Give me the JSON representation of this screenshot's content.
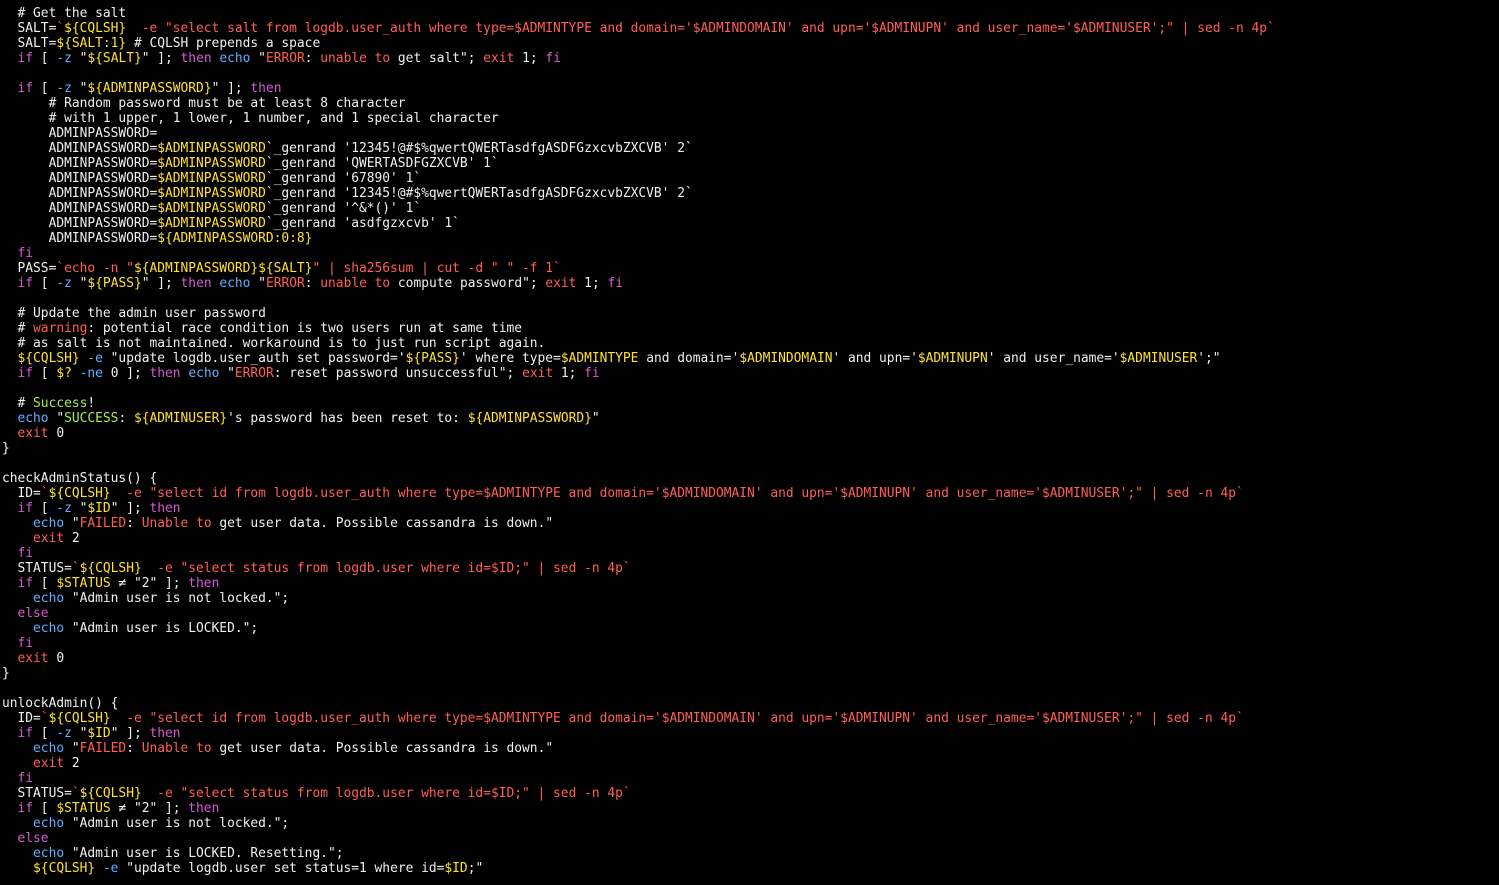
{
  "terminal": {
    "lines": [
      [
        [
          "w",
          "  # Get the salt"
        ]
      ],
      [
        [
          "w",
          "  SALT="
        ],
        [
          "r",
          "`"
        ],
        [
          "y",
          "${CQLSH}"
        ],
        [
          "r",
          "  -e \"select salt from logdb.user_auth where type=$ADMINTYPE and domain='$ADMINDOMAIN' and upn='$ADMINUPN' and user_name='$ADMINUSER';\" | sed -n 4p`"
        ]
      ],
      [
        [
          "w",
          "  SALT="
        ],
        [
          "y",
          "${SALT:1}"
        ],
        [
          "w",
          " # CQLSH prepends a space"
        ]
      ],
      [
        [
          "m",
          "  if"
        ],
        [
          "w",
          " [ "
        ],
        [
          "c",
          "-z"
        ],
        [
          "w",
          " \""
        ],
        [
          "y",
          "${SALT}"
        ],
        [
          "w",
          "\" ]; "
        ],
        [
          "m",
          "then"
        ],
        [
          "w",
          " "
        ],
        [
          "c",
          "echo"
        ],
        [
          "w",
          " \""
        ],
        [
          "r",
          "ERROR"
        ],
        [
          "w",
          ": "
        ],
        [
          "r",
          "unable"
        ],
        [
          "w",
          " "
        ],
        [
          "r",
          "to"
        ],
        [
          "w",
          " get salt\"; "
        ],
        [
          "r",
          "exit"
        ],
        [
          "w",
          " 1; "
        ],
        [
          "m",
          "fi"
        ]
      ],
      [
        [
          "w",
          ""
        ]
      ],
      [
        [
          "m",
          "  if"
        ],
        [
          "w",
          " [ "
        ],
        [
          "c",
          "-z"
        ],
        [
          "w",
          " \""
        ],
        [
          "y",
          "${ADMINPASSWORD}"
        ],
        [
          "w",
          "\" ]; "
        ],
        [
          "m",
          "then"
        ]
      ],
      [
        [
          "w",
          "      # Random password must be at least 8 character"
        ]
      ],
      [
        [
          "w",
          "      # with 1 upper, 1 lower, 1 number, and 1 special character"
        ]
      ],
      [
        [
          "w",
          "      ADMINPASSWORD="
        ]
      ],
      [
        [
          "w",
          "      ADMINPASSWORD="
        ],
        [
          "y",
          "$ADMINPASSWORD"
        ],
        [
          "w",
          "`_genrand '12345!@#$%qwertQWERTasdfgASDFGzxcvbZXCVB' 2`"
        ]
      ],
      [
        [
          "w",
          "      ADMINPASSWORD="
        ],
        [
          "y",
          "$ADMINPASSWORD"
        ],
        [
          "w",
          "`_genrand 'QWERTASDFGZXCVB' 1`"
        ]
      ],
      [
        [
          "w",
          "      ADMINPASSWORD="
        ],
        [
          "y",
          "$ADMINPASSWORD"
        ],
        [
          "w",
          "`_genrand '67890' 1`"
        ]
      ],
      [
        [
          "w",
          "      ADMINPASSWORD="
        ],
        [
          "y",
          "$ADMINPASSWORD"
        ],
        [
          "w",
          "`_genrand '12345!@#$%qwertQWERTasdfgASDFGzxcvbZXCVB' 2`"
        ]
      ],
      [
        [
          "w",
          "      ADMINPASSWORD="
        ],
        [
          "y",
          "$ADMINPASSWORD"
        ],
        [
          "w",
          "`_genrand '^&*()' 1`"
        ]
      ],
      [
        [
          "w",
          "      ADMINPASSWORD="
        ],
        [
          "y",
          "$ADMINPASSWORD"
        ],
        [
          "w",
          "`_genrand 'asdfgzxcvb' 1`"
        ]
      ],
      [
        [
          "w",
          "      ADMINPASSWORD="
        ],
        [
          "y",
          "${ADMINPASSWORD:0:8}"
        ]
      ],
      [
        [
          "m",
          "  fi"
        ]
      ],
      [
        [
          "w",
          "  PASS="
        ],
        [
          "r",
          "`echo -n \""
        ],
        [
          "y",
          "${ADMINPASSWORD}${SALT}"
        ],
        [
          "r",
          "\" | sha256sum | cut -d \" \" -f 1`"
        ]
      ],
      [
        [
          "m",
          "  if"
        ],
        [
          "w",
          " [ "
        ],
        [
          "c",
          "-z"
        ],
        [
          "w",
          " \""
        ],
        [
          "y",
          "${PASS}"
        ],
        [
          "w",
          "\" ]; "
        ],
        [
          "m",
          "then"
        ],
        [
          "w",
          " "
        ],
        [
          "c",
          "echo"
        ],
        [
          "w",
          " \""
        ],
        [
          "r",
          "ERROR"
        ],
        [
          "w",
          ": "
        ],
        [
          "r",
          "unable"
        ],
        [
          "w",
          " "
        ],
        [
          "r",
          "to"
        ],
        [
          "w",
          " compute password\"; "
        ],
        [
          "r",
          "exit"
        ],
        [
          "w",
          " 1; "
        ],
        [
          "m",
          "fi"
        ]
      ],
      [
        [
          "w",
          ""
        ]
      ],
      [
        [
          "w",
          "  # Update the admin user password"
        ]
      ],
      [
        [
          "w",
          "  # "
        ],
        [
          "r",
          "warning"
        ],
        [
          "w",
          ": potential race condition is two users run at same time"
        ]
      ],
      [
        [
          "w",
          "  # as salt is not maintained. workaround is to just run script again."
        ]
      ],
      [
        [
          "y",
          "  ${CQLSH}"
        ],
        [
          "w",
          " "
        ],
        [
          "c",
          "-e"
        ],
        [
          "w",
          " \"update logdb.user_auth set password='"
        ],
        [
          "y",
          "${PASS}"
        ],
        [
          "w",
          "' where type="
        ],
        [
          "y",
          "$ADMINTYPE"
        ],
        [
          "w",
          " and domain='"
        ],
        [
          "y",
          "$ADMINDOMAIN"
        ],
        [
          "w",
          "' and upn='"
        ],
        [
          "y",
          "$ADMINUPN"
        ],
        [
          "w",
          "' and user_name='"
        ],
        [
          "y",
          "$ADMINUSER"
        ],
        [
          "w",
          "';\""
        ]
      ],
      [
        [
          "m",
          "  if"
        ],
        [
          "w",
          " [ "
        ],
        [
          "y",
          "$?"
        ],
        [
          "w",
          " "
        ],
        [
          "c",
          "-ne"
        ],
        [
          "w",
          " 0 ]; "
        ],
        [
          "m",
          "then"
        ],
        [
          "w",
          " "
        ],
        [
          "c",
          "echo"
        ],
        [
          "w",
          " \""
        ],
        [
          "r",
          "ERROR"
        ],
        [
          "w",
          ": reset password unsuccessful\"; "
        ],
        [
          "r",
          "exit"
        ],
        [
          "w",
          " 1; "
        ],
        [
          "m",
          "fi"
        ]
      ],
      [
        [
          "w",
          ""
        ]
      ],
      [
        [
          "w",
          "  # "
        ],
        [
          "g",
          "Success"
        ],
        [
          "w",
          "!"
        ]
      ],
      [
        [
          "c",
          "  echo"
        ],
        [
          "w",
          " \""
        ],
        [
          "g",
          "SUCCESS"
        ],
        [
          "w",
          ": "
        ],
        [
          "y",
          "${ADMINUSER}"
        ],
        [
          "w",
          "'s password has been reset to: "
        ],
        [
          "y",
          "${ADMINPASSWORD}"
        ],
        [
          "w",
          "\""
        ]
      ],
      [
        [
          "r",
          "  exit"
        ],
        [
          "w",
          " 0"
        ]
      ],
      [
        [
          "w",
          "}"
        ]
      ],
      [
        [
          "w",
          ""
        ]
      ],
      [
        [
          "w",
          "checkAdminStatus() {"
        ]
      ],
      [
        [
          "w",
          "  ID="
        ],
        [
          "r",
          "`"
        ],
        [
          "y",
          "${CQLSH}"
        ],
        [
          "r",
          "  -e \"select id from logdb.user_auth where type=$ADMINTYPE and domain='$ADMINDOMAIN' and upn='$ADMINUPN' and user_name='$ADMINUSER';\" | sed -n 4p`"
        ]
      ],
      [
        [
          "m",
          "  if"
        ],
        [
          "w",
          " [ "
        ],
        [
          "c",
          "-z"
        ],
        [
          "w",
          " \""
        ],
        [
          "y",
          "$ID"
        ],
        [
          "w",
          "\" ]; "
        ],
        [
          "m",
          "then"
        ]
      ],
      [
        [
          "c",
          "    echo"
        ],
        [
          "w",
          " \""
        ],
        [
          "r",
          "FAILED"
        ],
        [
          "w",
          ": "
        ],
        [
          "r",
          "Unable"
        ],
        [
          "w",
          " "
        ],
        [
          "r",
          "to"
        ],
        [
          "w",
          " get user data. Possible cassandra is down.\""
        ]
      ],
      [
        [
          "r",
          "    exit"
        ],
        [
          "w",
          " 2"
        ]
      ],
      [
        [
          "m",
          "  fi"
        ]
      ],
      [
        [
          "w",
          "  STATUS="
        ],
        [
          "r",
          "`"
        ],
        [
          "y",
          "${CQLSH}"
        ],
        [
          "r",
          "  -e \"select status from logdb.user where id=$ID;\" | sed -n 4p`"
        ]
      ],
      [
        [
          "m",
          "  if"
        ],
        [
          "w",
          " [ "
        ],
        [
          "y",
          "$STATUS"
        ],
        [
          "w",
          " ≠ \"2\" ]; "
        ],
        [
          "m",
          "then"
        ]
      ],
      [
        [
          "c",
          "    echo"
        ],
        [
          "w",
          " \"Admin user is not locked.\";"
        ]
      ],
      [
        [
          "m",
          "  else"
        ]
      ],
      [
        [
          "c",
          "    echo"
        ],
        [
          "w",
          " \"Admin user is LOCKED.\";"
        ]
      ],
      [
        [
          "m",
          "  fi"
        ]
      ],
      [
        [
          "r",
          "  exit"
        ],
        [
          "w",
          " 0"
        ]
      ],
      [
        [
          "w",
          "}"
        ]
      ],
      [
        [
          "w",
          ""
        ]
      ],
      [
        [
          "w",
          "unlockAdmin() {"
        ]
      ],
      [
        [
          "w",
          "  ID="
        ],
        [
          "r",
          "`"
        ],
        [
          "y",
          "${CQLSH}"
        ],
        [
          "r",
          "  -e \"select id from logdb.user_auth where type=$ADMINTYPE and domain='$ADMINDOMAIN' and upn='$ADMINUPN' and user_name='$ADMINUSER';\" | sed -n 4p`"
        ]
      ],
      [
        [
          "m",
          "  if"
        ],
        [
          "w",
          " [ "
        ],
        [
          "c",
          "-z"
        ],
        [
          "w",
          " \""
        ],
        [
          "y",
          "$ID"
        ],
        [
          "w",
          "\" ]; "
        ],
        [
          "m",
          "then"
        ]
      ],
      [
        [
          "c",
          "    echo"
        ],
        [
          "w",
          " \""
        ],
        [
          "r",
          "FAILED"
        ],
        [
          "w",
          ": "
        ],
        [
          "r",
          "Unable"
        ],
        [
          "w",
          " "
        ],
        [
          "r",
          "to"
        ],
        [
          "w",
          " get user data. Possible cassandra is down.\""
        ]
      ],
      [
        [
          "r",
          "    exit"
        ],
        [
          "w",
          " 2"
        ]
      ],
      [
        [
          "m",
          "  fi"
        ]
      ],
      [
        [
          "w",
          "  STATUS="
        ],
        [
          "r",
          "`"
        ],
        [
          "y",
          "${CQLSH}"
        ],
        [
          "r",
          "  -e \"select status from logdb.user where id=$ID;\" | sed -n 4p`"
        ]
      ],
      [
        [
          "m",
          "  if"
        ],
        [
          "w",
          " [ "
        ],
        [
          "y",
          "$STATUS"
        ],
        [
          "w",
          " ≠ \"2\" ]; "
        ],
        [
          "m",
          "then"
        ]
      ],
      [
        [
          "c",
          "    echo"
        ],
        [
          "w",
          " \"Admin user is not locked.\";"
        ]
      ],
      [
        [
          "m",
          "  else"
        ]
      ],
      [
        [
          "c",
          "    echo"
        ],
        [
          "w",
          " \"Admin user is LOCKED. Resetting.\";"
        ]
      ],
      [
        [
          "y",
          "    ${CQLSH}"
        ],
        [
          "w",
          " "
        ],
        [
          "c",
          "-e"
        ],
        [
          "w",
          " \"update logdb.user set status=1 where id="
        ],
        [
          "y",
          "$ID"
        ],
        [
          "w",
          ";\""
        ]
      ]
    ]
  }
}
